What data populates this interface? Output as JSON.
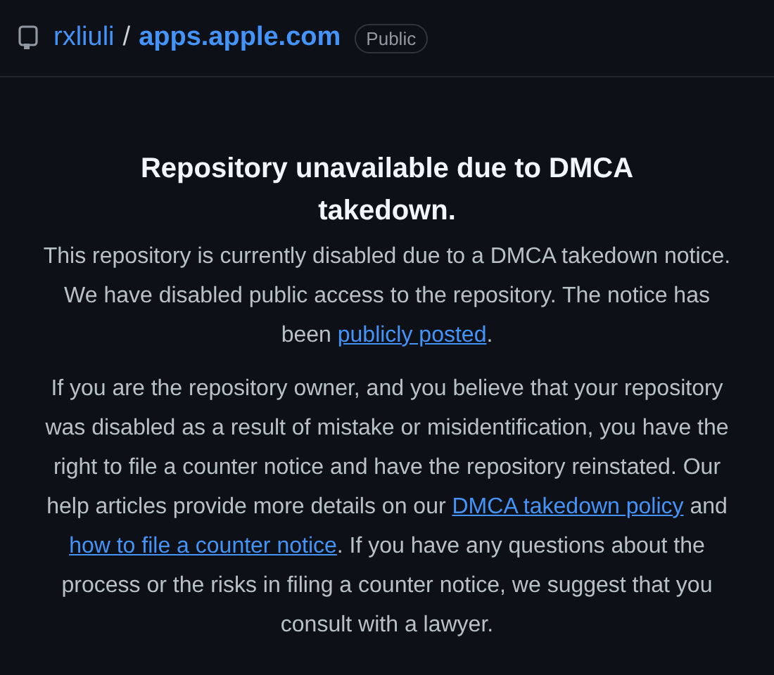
{
  "repo": {
    "owner": "rxliuli",
    "separator": "/",
    "name": "apps.apple.com",
    "visibility": "Public"
  },
  "notice": {
    "title": "Repository unavailable due to DMCA takedown.",
    "paragraphs": [
      [
        {
          "kind": "text",
          "text": "This repository is currently disabled due to a DMCA takedown notice. We have disabled public access to the repository. The notice has been "
        },
        {
          "kind": "link",
          "text": "publicly posted"
        },
        {
          "kind": "text",
          "text": "."
        }
      ],
      [
        {
          "kind": "text",
          "text": "If you are the repository owner, and you believe that your repository was disabled as a result of mistake or misidentification, you have the right to file a counter notice and have the repository reinstated. Our help articles provide more details on our "
        },
        {
          "kind": "link",
          "text": "DMCA takedown policy"
        },
        {
          "kind": "text",
          "text": " and "
        },
        {
          "kind": "link",
          "text": "how to file a counter notice"
        },
        {
          "kind": "text",
          "text": ". If you have any questions about the process or the risks in filing a counter notice, we suggest that you consult with a lawyer."
        }
      ]
    ]
  }
}
